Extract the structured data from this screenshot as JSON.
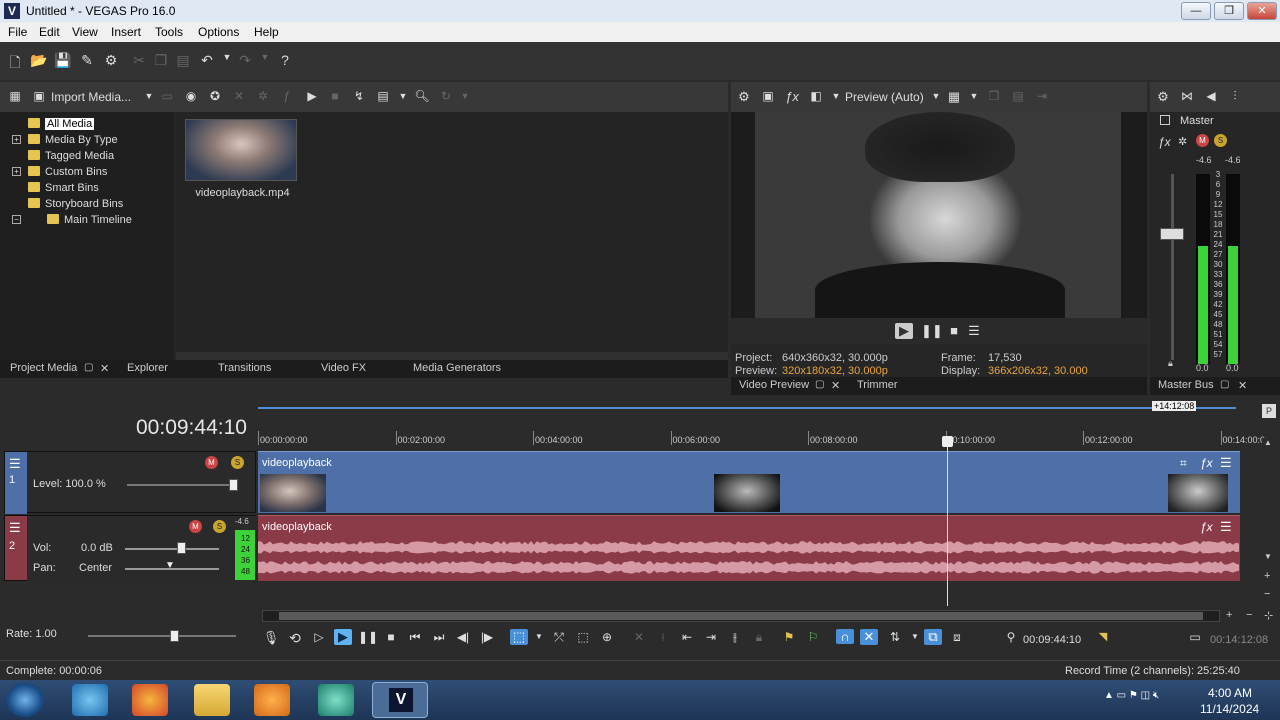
{
  "window": {
    "title": "Untitled * - VEGAS Pro 16.0",
    "app_icon": "V",
    "minimize": "—",
    "maximize": "❐",
    "close": "✕"
  },
  "menu": [
    "File",
    "Edit",
    "View",
    "Insert",
    "Tools",
    "Options",
    "Help"
  ],
  "media_panel": {
    "import_label": "Import Media...",
    "tree": [
      {
        "label": "All Media"
      },
      {
        "label": "Media By Type"
      },
      {
        "label": "Tagged Media"
      },
      {
        "label": "Custom Bins"
      },
      {
        "label": "Smart Bins"
      },
      {
        "label": "Storyboard Bins"
      },
      {
        "label": "Main Timeline"
      }
    ],
    "tree_expanders": [
      "+",
      "+",
      "−"
    ],
    "file_name": "videoplayback.mp4",
    "tabs": [
      "Project Media",
      "Explorer",
      "Transitions",
      "Video FX",
      "Media Generators"
    ]
  },
  "preview": {
    "mode": "Preview (Auto)",
    "project_label": "Project:",
    "project_value": "640x360x32, 30.000p",
    "preview_label": "Preview:",
    "preview_value": "320x180x32, 30.000p",
    "frame_label": "Frame:",
    "frame_value": "17,530",
    "display_label": "Display:",
    "display_value": "366x206x32, 30.000",
    "tabs": [
      "Video Preview",
      "Trimmer"
    ]
  },
  "master": {
    "label": "Master",
    "peak_left": "-4.6",
    "peak_right": "-4.6",
    "scale": [
      "3",
      "6",
      "9",
      "12",
      "15",
      "18",
      "21",
      "24",
      "27",
      "30",
      "33",
      "36",
      "39",
      "42",
      "45",
      "48",
      "51",
      "54",
      "57"
    ],
    "bottom_left": "0.0",
    "bottom_right": "0.0",
    "level_left": 0.62,
    "level_right": 0.62,
    "tab": "Master Bus"
  },
  "timeline": {
    "timecode": "00:09:44:10",
    "loop_end": "+14:12:08",
    "ruler": [
      "00:00:00:00",
      "00:02:00:00",
      "00:04:00:00",
      "00:06:00:00",
      "00:08:00:00",
      "00:10:00:00",
      "00:12:00:00",
      "00:14:00:0"
    ],
    "playhead_fraction": 0.688,
    "video_track": {
      "number": "1",
      "level": "Level: 100.0 %",
      "clip": "videoplayback"
    },
    "audio_track": {
      "number": "2",
      "vol_label": "Vol:",
      "vol_value": "0.0 dB",
      "pan_label": "Pan:",
      "pan_value": "Center",
      "meter_peak": "-4.6",
      "meter_marks": [
        "12",
        "24",
        "36",
        "48"
      ],
      "clip": "videoplayback"
    },
    "rate": "Rate: 1.00",
    "transport_time": "00:09:44:10",
    "end_time": "00:14:12:08"
  },
  "status": {
    "left": "Complete: 00:00:06",
    "right": "Record Time (2 channels): 25:25:40"
  },
  "taskbar": {
    "time": "4:00 AM",
    "date": "11/14/2024"
  },
  "colors": {
    "video_track": "#4e6fa8",
    "audio_track": "#8b3a48",
    "meter_green": "#3ed23a",
    "accent": "#2f8fe0"
  }
}
